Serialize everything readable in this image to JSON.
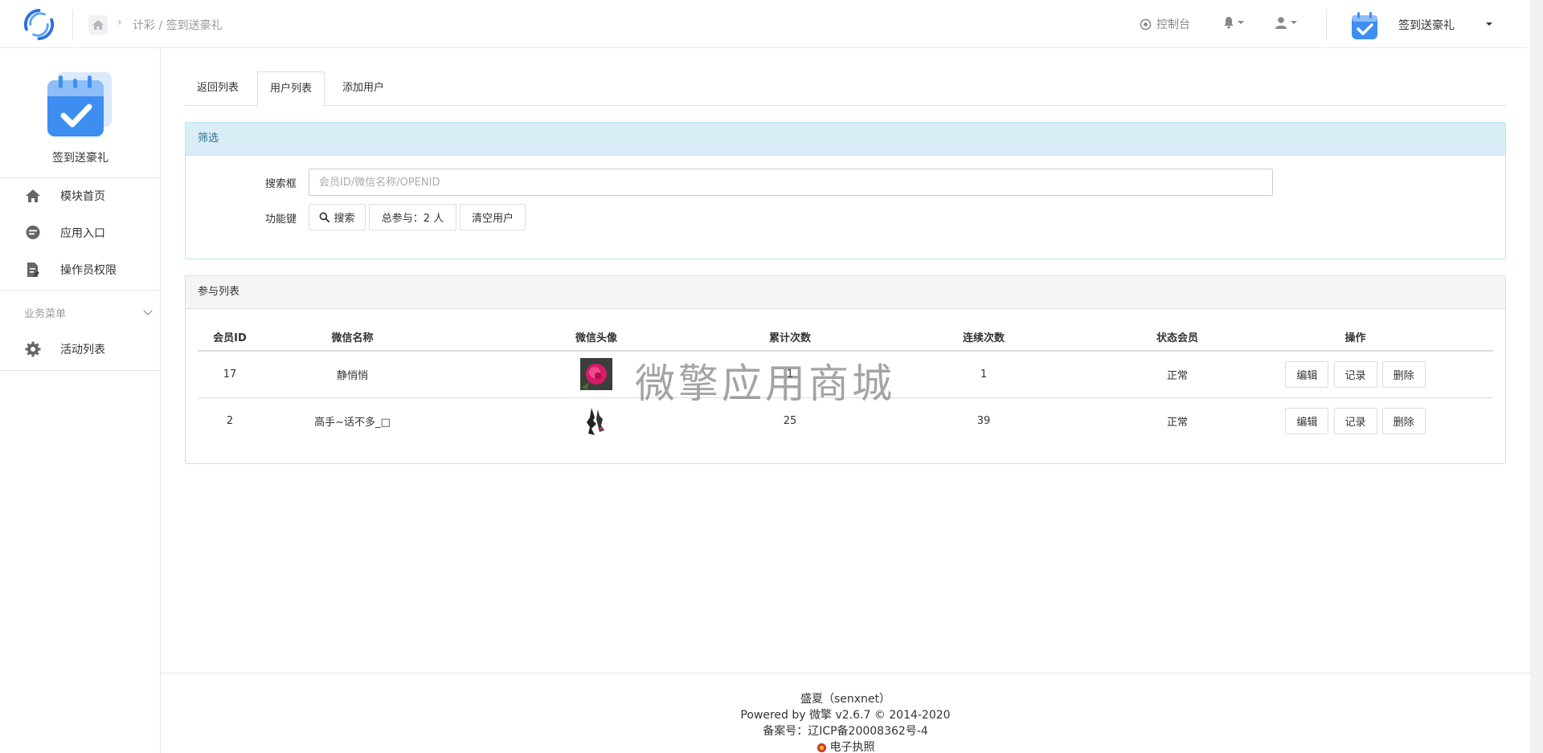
{
  "header": {
    "breadcrumb": "计彩 / 签到送豪礼",
    "console_label": "控制台",
    "app_name": "签到送豪礼"
  },
  "sidebar": {
    "title": "签到送豪礼",
    "items": [
      {
        "label": "模块首页"
      },
      {
        "label": "应用入口"
      },
      {
        "label": "操作员权限"
      }
    ],
    "group_label": "业务菜单",
    "group_items": [
      {
        "label": "活动列表"
      }
    ]
  },
  "tabs": [
    {
      "label": "返回列表"
    },
    {
      "label": "用户列表"
    },
    {
      "label": "添加用户"
    }
  ],
  "filter": {
    "title": "筛选",
    "search_label": "搜索框",
    "search_placeholder": "会员ID/微信名称/OPENID",
    "function_label": "功能键",
    "search_button": "搜索",
    "total_button": "总参与：2 人",
    "clear_button": "清空用户"
  },
  "list": {
    "title": "参与列表",
    "columns": [
      "会员ID",
      "微信名称",
      "微信头像",
      "累计次数",
      "连续次数",
      "状态会员",
      "操作"
    ],
    "rows": [
      {
        "id": "17",
        "name": "静悄悄",
        "total": "1",
        "streak": "1",
        "status": "正常"
      },
      {
        "id": "2",
        "name": "高手~话不多_□",
        "total": "25",
        "streak": "39",
        "status": "正常"
      }
    ],
    "actions": {
      "edit": "编辑",
      "record": "记录",
      "delete": "删除"
    }
  },
  "watermark": "微擎应用商城",
  "footer": {
    "line1": "盛夏（senxnet）",
    "line2": "Powered by 微擎 v2.6.7 © 2014-2020",
    "line3": "备案号：辽ICP备20008362号-4",
    "line4": "电子执照"
  },
  "colors": {
    "brand_blue": "#3d8ef0",
    "info_bg": "#d9edf7",
    "info_text": "#31708f"
  }
}
